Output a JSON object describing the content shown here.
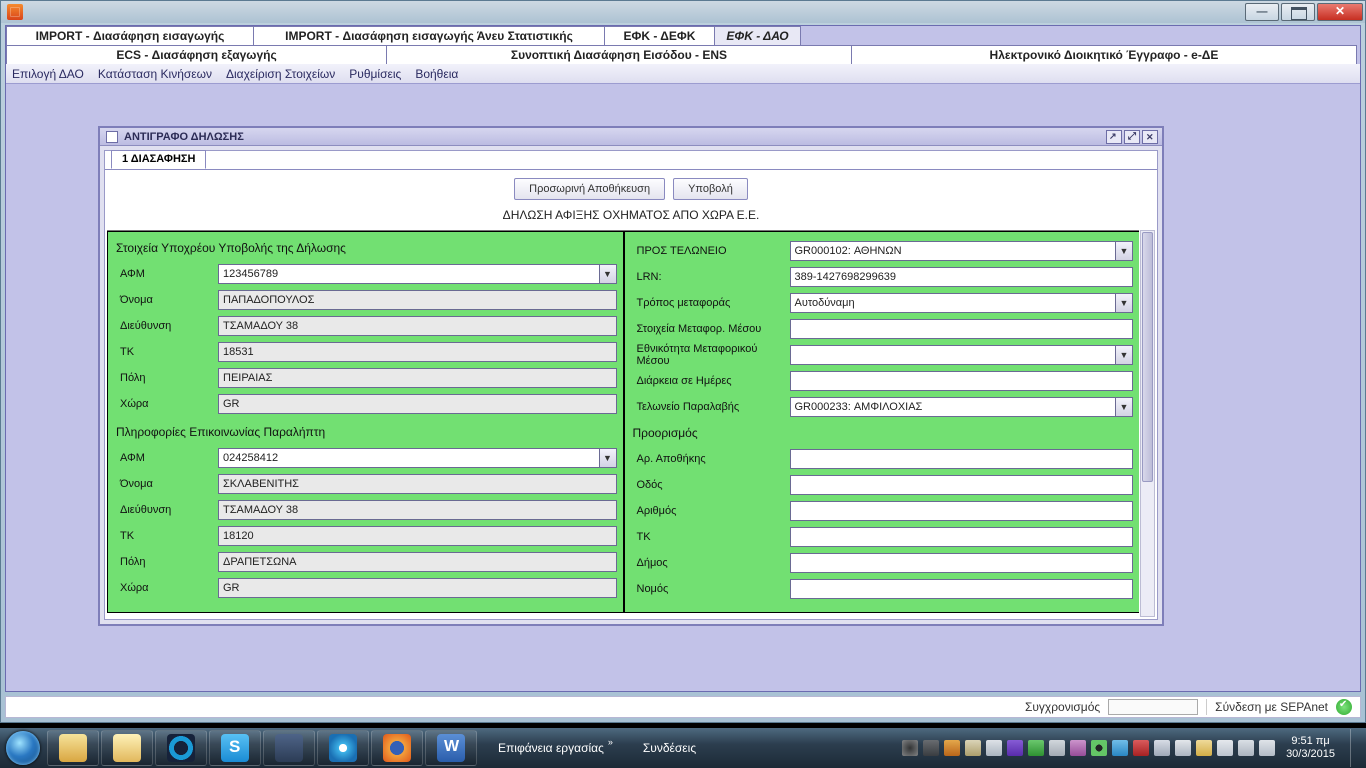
{
  "tabs_row1": [
    "IMPORT - Διασάφηση εισαγωγής",
    "IMPORT - Διασάφηση εισαγωγής Άνευ Στατιστικής",
    "ΕΦΚ - ΔΕΦΚ",
    "ΕΦΚ - ΔΑΟ"
  ],
  "tabs_row2": [
    "ECS - Διασάφηση εξαγωγής",
    "Συνοπτική Διασάφηση Εισόδου - ENS",
    "Ηλεκτρονικό Διοικητικό Έγγραφο - e-ΔΕ"
  ],
  "menubar": [
    "Επιλογή ΔΑΟ",
    "Κατάσταση Κινήσεων",
    "Διαχείριση Στοιχείων",
    "Ρυθμίσεις",
    "Βοήθεια"
  ],
  "iw_title": "ΑΝΤΙΓΡΑΦΟ ΔΗΛΩΣΗΣ",
  "iw_tab": "1 ΔΙΑΣΑΦΗΣΗ",
  "btn_save": "Προσωρινή Αποθήκευση",
  "btn_submit": "Υποβολή",
  "form_title": "ΔΗΛΩΣΗ ΑΦΙΞΗΣ ΟΧΗΜΑΤΟΣ ΑΠΟ ΧΩΡΑ Ε.Ε.",
  "left": {
    "section1": "Στοιχεία Υποχρέου Υποβολής της Δήλωσης",
    "afm_l": "ΑΦΜ",
    "afm_v": "123456789",
    "name_l": "Όνομα",
    "name_v": "ΠΑΠΑΔΟΠΟΥΛΟΣ",
    "addr_l": "Διεύθυνση",
    "addr_v": "ΤΣΑΜΑΔΟΥ 38",
    "tk_l": "ΤΚ",
    "tk_v": "18531",
    "city_l": "Πόλη",
    "city_v": "ΠΕΙΡΑΙΑΣ",
    "country_l": "Χώρα",
    "country_v": "GR",
    "section2": "Πληροφορίες Επικοινωνίας Παραλήπτη",
    "afm2_l": "ΑΦΜ",
    "afm2_v": "024258412",
    "name2_l": "Όνομα",
    "name2_v": "ΣΚΛΑΒΕΝΙΤΗΣ",
    "addr2_l": "Διεύθυνση",
    "addr2_v": "ΤΣΑΜΑΔΟΥ 38",
    "tk2_l": "ΤΚ",
    "tk2_v": "18120",
    "city2_l": "Πόλη",
    "city2_v": "ΔΡΑΠΕΤΣΩΝΑ",
    "country2_l": "Χώρα",
    "country2_v": "GR"
  },
  "right": {
    "customs_l": "ΠΡΟΣ ΤΕΛΩΝΕΙΟ",
    "customs_v": "GR000102: ΑΘΗΝΩΝ",
    "lrn_l": "LRN:",
    "lrn_v": "389-1427698299639",
    "mode_l": "Τρόπος μεταφοράς",
    "mode_v": "Αυτοδύναμη",
    "vehinfo_l": "Στοιχεία Μεταφορ. Μέσου",
    "vehinfo_v": "",
    "nat_l": "Εθνικότητα Μεταφορικού Μέσου",
    "nat_v": "",
    "days_l": "Διάρκεια σε Ημέρες",
    "days_v": "",
    "recv_l": "Τελωνείο Παραλαβής",
    "recv_v": "GR000233: ΑΜΦΙΛΟΧΙΑΣ",
    "dest_head": "Προορισμός",
    "wh_l": "Αρ. Αποθήκης",
    "wh_v": "",
    "street_l": "Οδός",
    "street_v": "",
    "num_l": "Αριθμός",
    "num_v": "",
    "dtk_l": "ΤΚ",
    "dtk_v": "",
    "mun_l": "Δήμος",
    "mun_v": "",
    "pref_l": "Νομός",
    "pref_v": ""
  },
  "status": {
    "sync": "Συγχρονισμός",
    "conn": "Σύνδεση με SEPAnet"
  },
  "taskbar": {
    "desk": "Επιφάνεια εργασίας",
    "links": "Συνδέσεις",
    "time": "9:51 πμ",
    "date": "30/3/2015"
  }
}
